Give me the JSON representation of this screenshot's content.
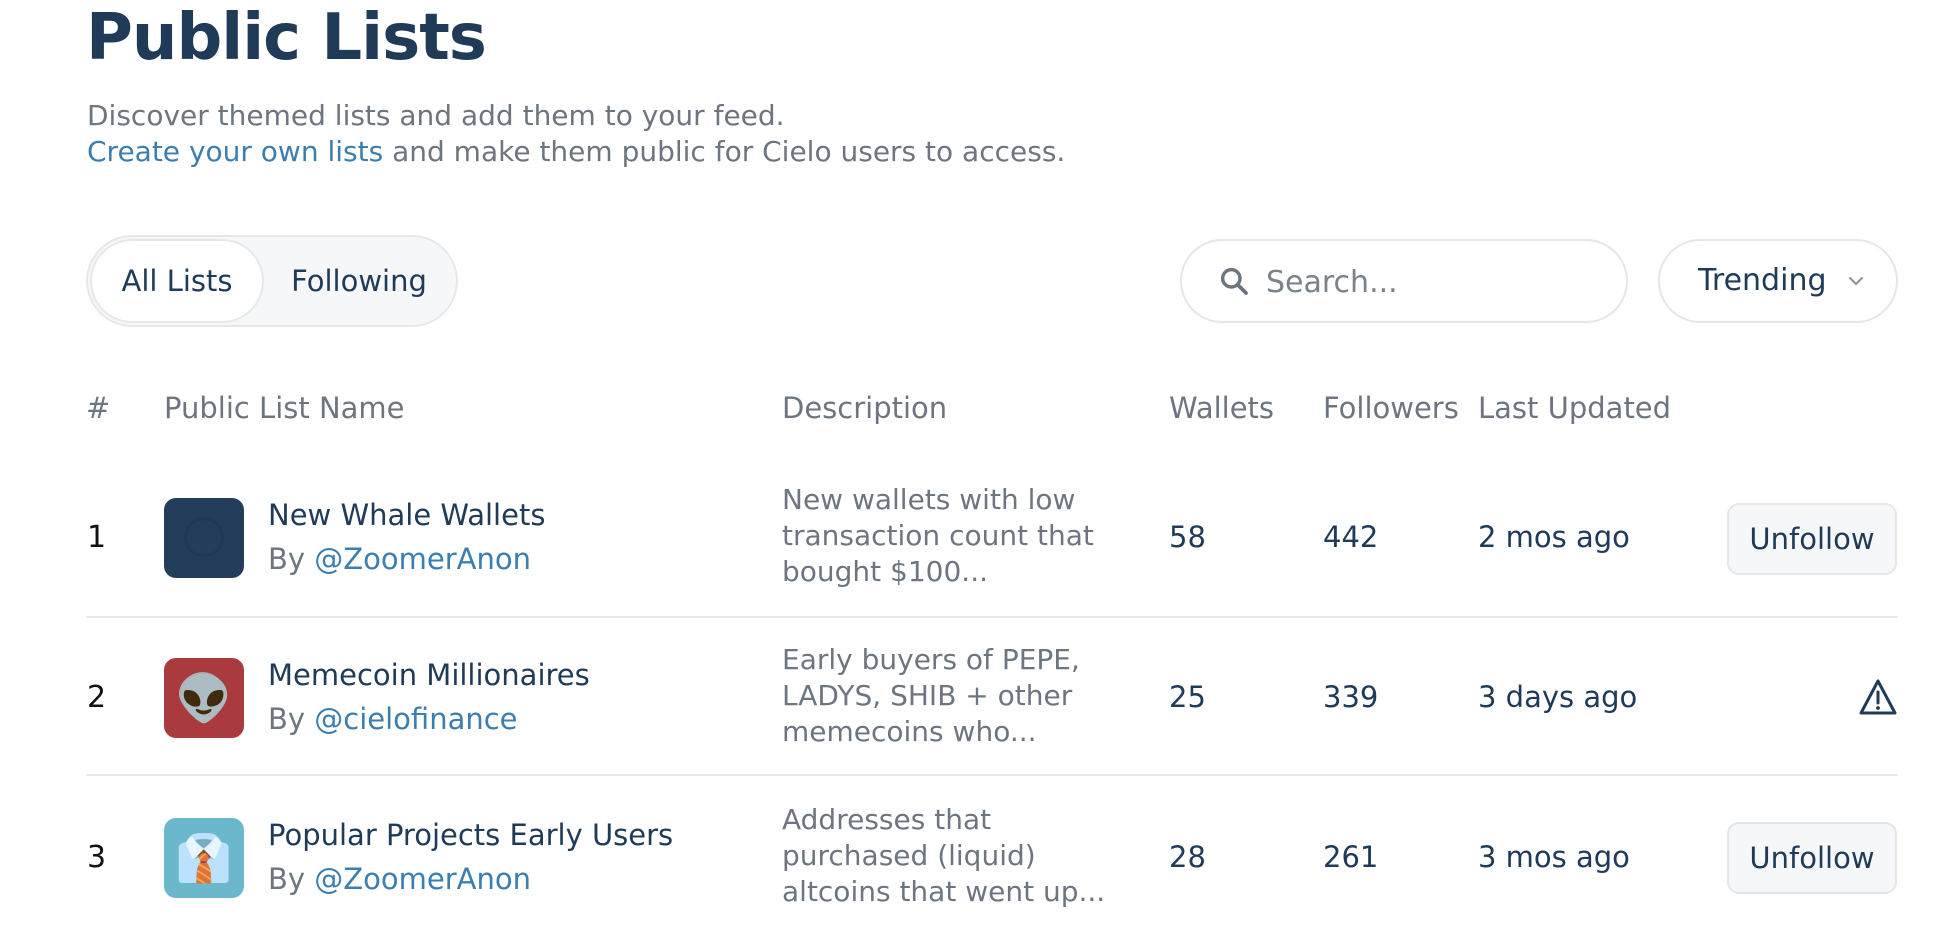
{
  "header": {
    "title": "Public Lists",
    "subtitle_line1": "Discover themed lists and add them to your feed.",
    "create_link": "Create your own lists",
    "subtitle_line2_rest": " and make them public for Cielo users to access."
  },
  "filters": {
    "tabs": [
      {
        "label": "All Lists",
        "active": true
      },
      {
        "label": "Following",
        "active": false
      }
    ],
    "search_placeholder": "Search...",
    "sort_label": "Trending"
  },
  "table": {
    "columns": [
      "#",
      "Public List Name",
      "Description",
      "Wallets",
      "Followers",
      "Last Updated"
    ],
    "rows": [
      {
        "rank": "1",
        "avatar_emoji": "🌕",
        "avatar_color": "#243d5a",
        "name": "New Whale Wallets",
        "by_prefix": "By ",
        "author": "@ZoomerAnon",
        "desc_lines": [
          "New wallets with low",
          "transaction count that",
          "bought $100..."
        ],
        "wallets": "58",
        "followers": "442",
        "updated": "2 mos ago",
        "action": "Unfollow"
      },
      {
        "rank": "2",
        "avatar_emoji": "👽",
        "avatar_color": "#a93b3e",
        "name": "Memecoin Millionaires",
        "by_prefix": "By ",
        "author": "@cielofinance",
        "desc_lines": [
          "Early buyers of PEPE,",
          "LADYS, SHIB + other",
          "memecoins who..."
        ],
        "wallets": "25",
        "followers": "339",
        "updated": "3 days ago",
        "action_icon": "warning-icon"
      },
      {
        "rank": "3",
        "avatar_emoji": "👔",
        "avatar_color": "#6bb8cc",
        "name": "Popular Projects Early Users",
        "by_prefix": "By ",
        "author": "@ZoomerAnon",
        "desc_lines": [
          "Addresses that",
          "purchased (liquid)",
          "altcoins that went up..."
        ],
        "wallets": "28",
        "followers": "261",
        "updated": "3 mos ago",
        "action": "Unfollow"
      }
    ]
  }
}
